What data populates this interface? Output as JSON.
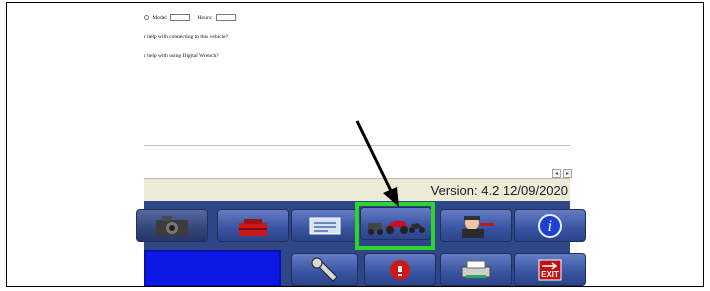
{
  "form": {
    "model_label": "Model",
    "hours_label": "Hours:",
    "question_connect": "r help with connecting to this vehicle?",
    "question_wrench": "r help with using Digital Wrench?"
  },
  "status_bar": {
    "version_text": "Version: 4.2 12/09/2020"
  },
  "toolbar": {
    "row1": [
      "camera-button",
      "toolbox-button",
      "document-button",
      "vehicles-button",
      "technician-button",
      "info-button"
    ],
    "row2": [
      "wrench-button",
      "stop-button",
      "printer-button",
      "exit-button"
    ],
    "exit_label": "EXIT",
    "info_label": "i"
  },
  "annotation": {
    "highlight_color": "#2dd52d",
    "arrow_color": "#000000"
  },
  "colors": {
    "toolbar_bg": "#2f4787",
    "status_bg": "#ecebd7",
    "blue_field": "#0b19e6"
  }
}
